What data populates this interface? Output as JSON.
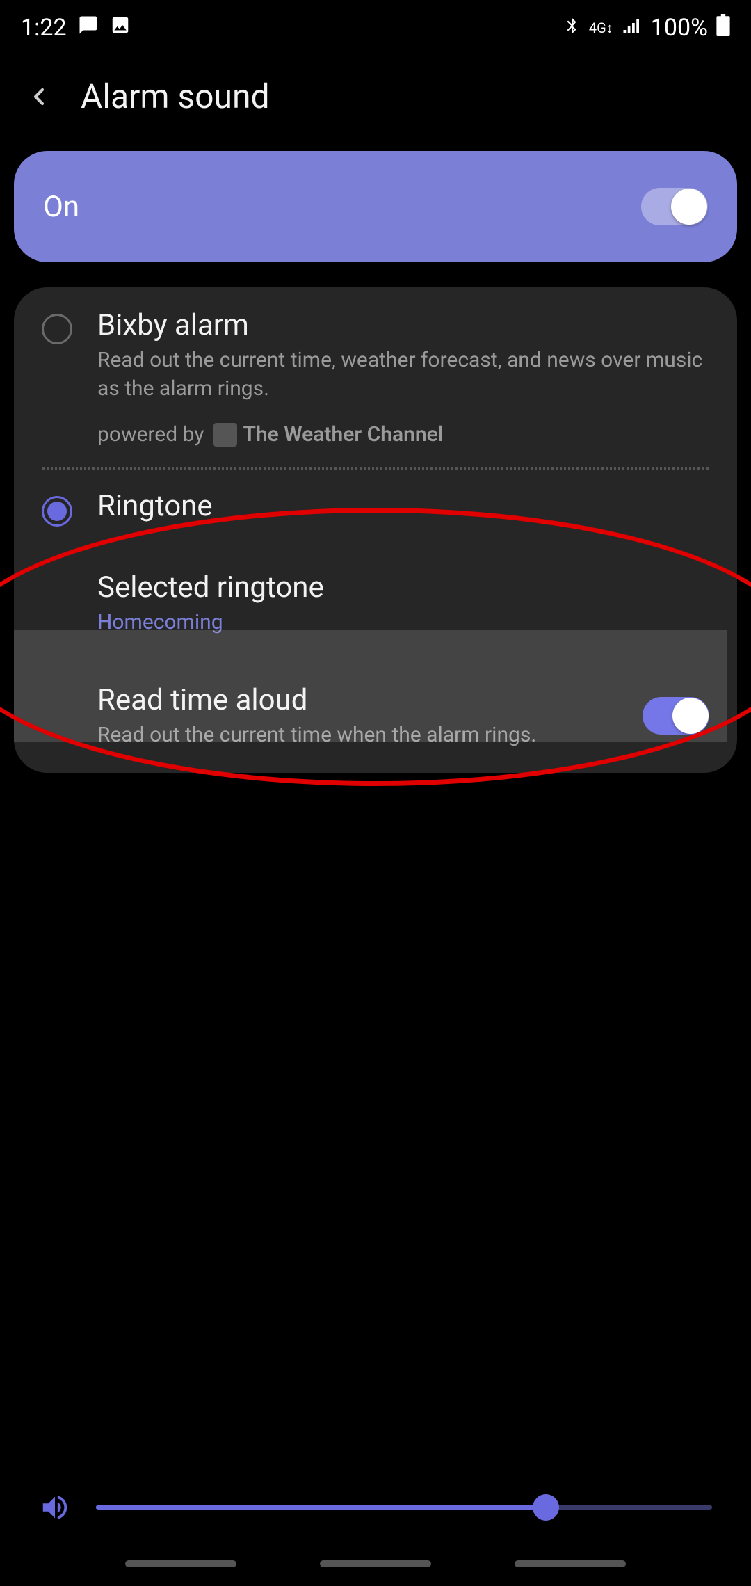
{
  "status": {
    "time": "1:22",
    "battery": "100%"
  },
  "header": {
    "title": "Alarm sound"
  },
  "onToggle": {
    "label": "On"
  },
  "bixby": {
    "title": "Bixby alarm",
    "description": "Read out the current time, weather forecast, and news over music as the alarm rings.",
    "poweredBy": "powered by",
    "vendor": "The Weather Channel"
  },
  "ringtone": {
    "label": "Ringtone"
  },
  "selected": {
    "label": "Selected ringtone",
    "value": "Homecoming"
  },
  "readTime": {
    "label": "Read time aloud",
    "description": "Read out the current time when the alarm rings."
  }
}
